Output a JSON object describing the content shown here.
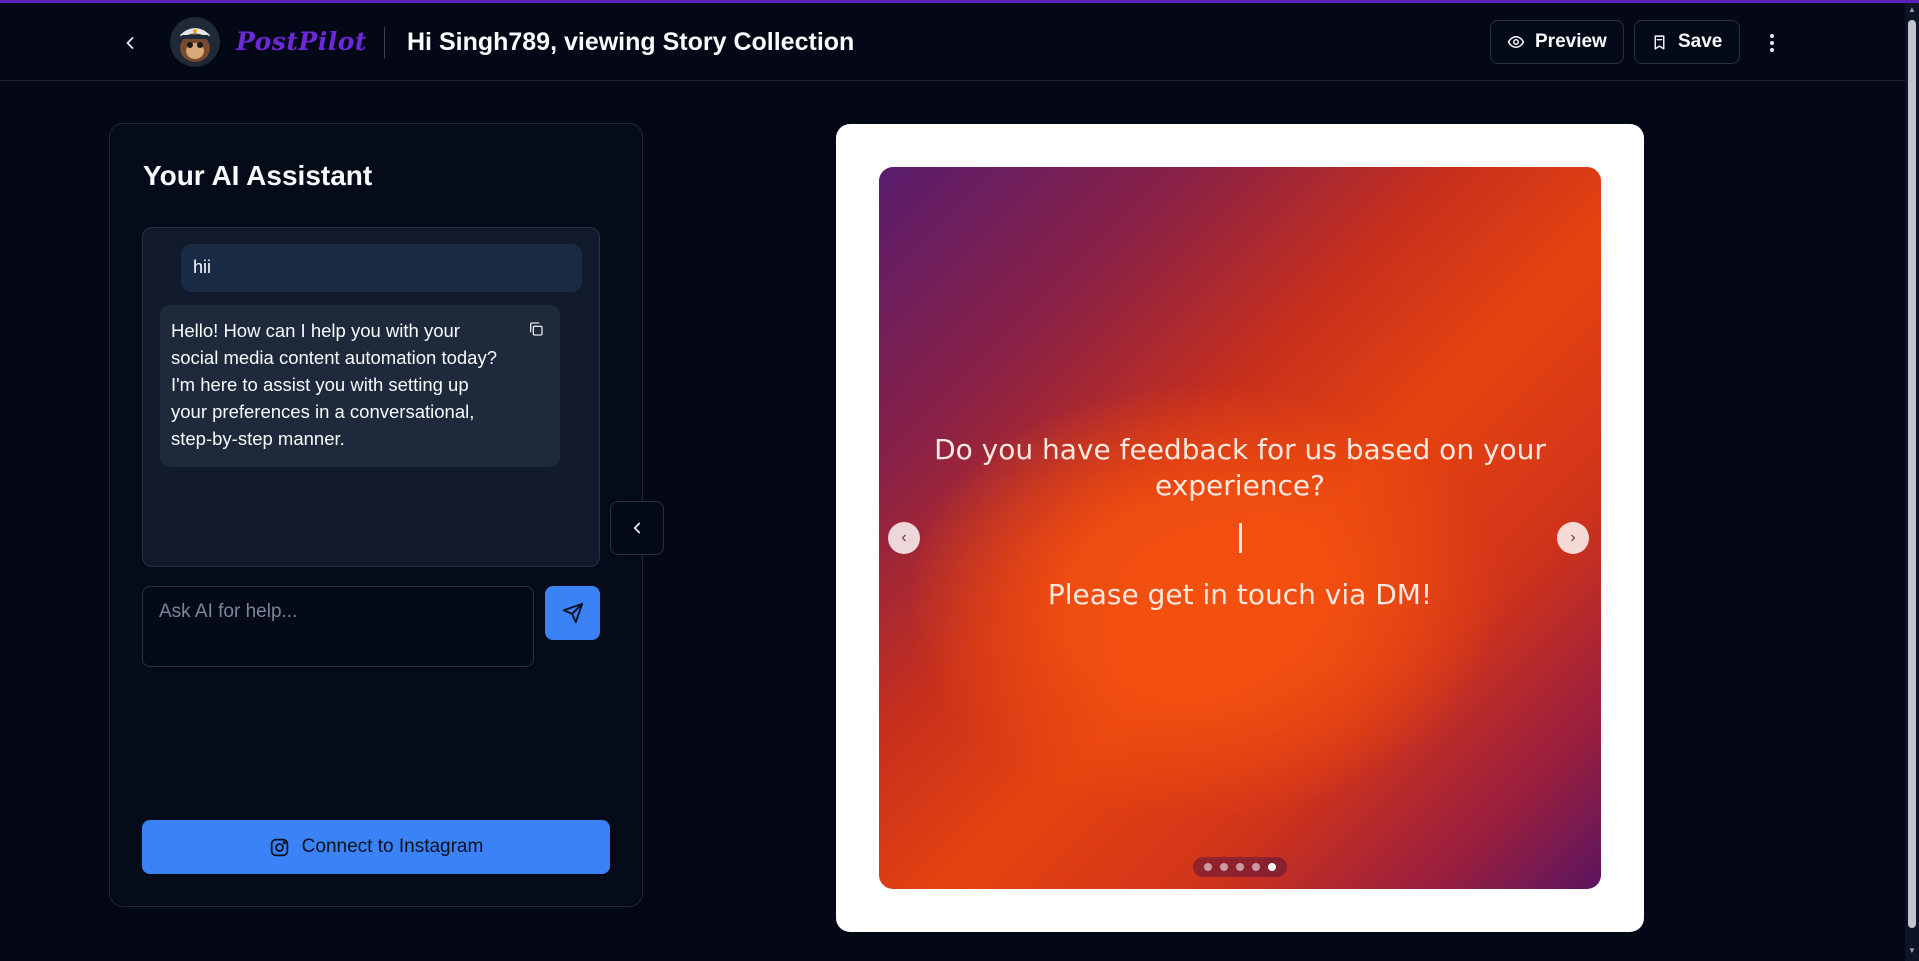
{
  "header": {
    "brand": "PostPilot",
    "title": "Hi Singh789, viewing Story Collection",
    "preview_label": "Preview",
    "save_label": "Save",
    "icons": {
      "back": "chevron-left-icon",
      "preview": "eye-icon",
      "save": "bookmark-icon",
      "more": "more-vertical-icon"
    }
  },
  "assistant": {
    "title": "Your AI Assistant",
    "messages": [
      {
        "role": "user",
        "text": "hii"
      },
      {
        "role": "assistant",
        "text": "Hello! How can I help you with your social media content automation today? I'm here to assist you with setting up your preferences in a conversational, step-by-step manner."
      }
    ],
    "input_placeholder": "Ask AI for help...",
    "input_value": "",
    "connect_label": "Connect to Instagram"
  },
  "story": {
    "question": "Do you have feedback for us based on your experience?",
    "cta": "Please get in touch via DM!",
    "slide_count": 5,
    "active_slide": 5,
    "prev_glyph": "‹",
    "next_glyph": "›"
  },
  "colors": {
    "accent": "#3b82f6",
    "brand": "#6d28d9",
    "background": "#040816"
  }
}
